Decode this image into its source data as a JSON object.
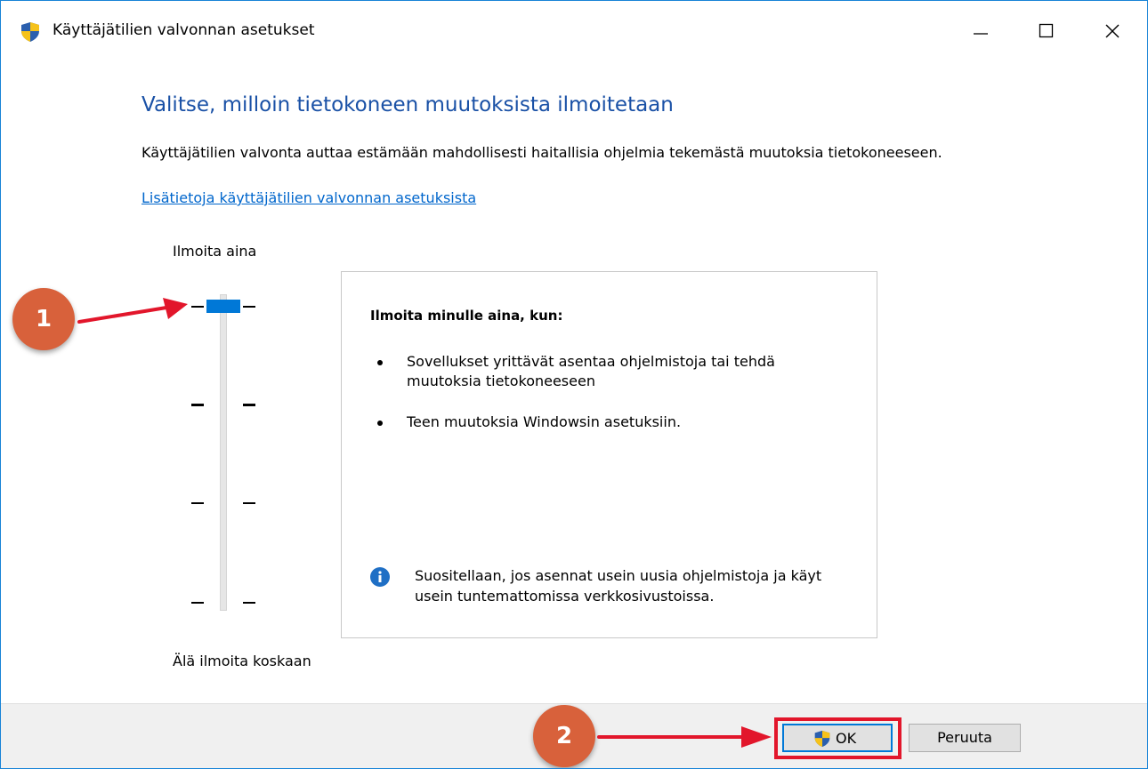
{
  "window": {
    "title": "Käyttäjätilien valvonnan asetukset"
  },
  "main": {
    "heading": "Valitse, milloin tietokoneen muutoksista ilmoitetaan",
    "description": "Käyttäjätilien valvonta auttaa estämään mahdollisesti haitallisia ohjelmia tekemästä muutoksia tietokoneeseen.",
    "link": "Lisätietoja käyttäjätilien valvonnan asetuksista"
  },
  "slider": {
    "top_label": "Ilmoita aina",
    "bottom_label": "Älä ilmoita koskaan",
    "levels": 4,
    "selected_level": 4
  },
  "info": {
    "title": "Ilmoita minulle aina, kun:",
    "bullets": [
      "Sovellukset yrittävät asentaa ohjelmistoja tai tehdä muutoksia tietokoneeseen",
      "Teen muutoksia Windowsin asetuksiin."
    ],
    "note": "Suositellaan, jos asennat usein uusia ohjelmistoja ja käyt usein tuntemattomissa verkkosivustoissa."
  },
  "buttons": {
    "ok": "OK",
    "cancel": "Peruuta"
  },
  "annotations": {
    "callout_1": "1",
    "callout_2": "2"
  },
  "colors": {
    "accent": "#0078d7",
    "heading": "#1a51a6",
    "link": "#0066cc",
    "callout": "#d8613b",
    "highlight": "#e2162b"
  }
}
